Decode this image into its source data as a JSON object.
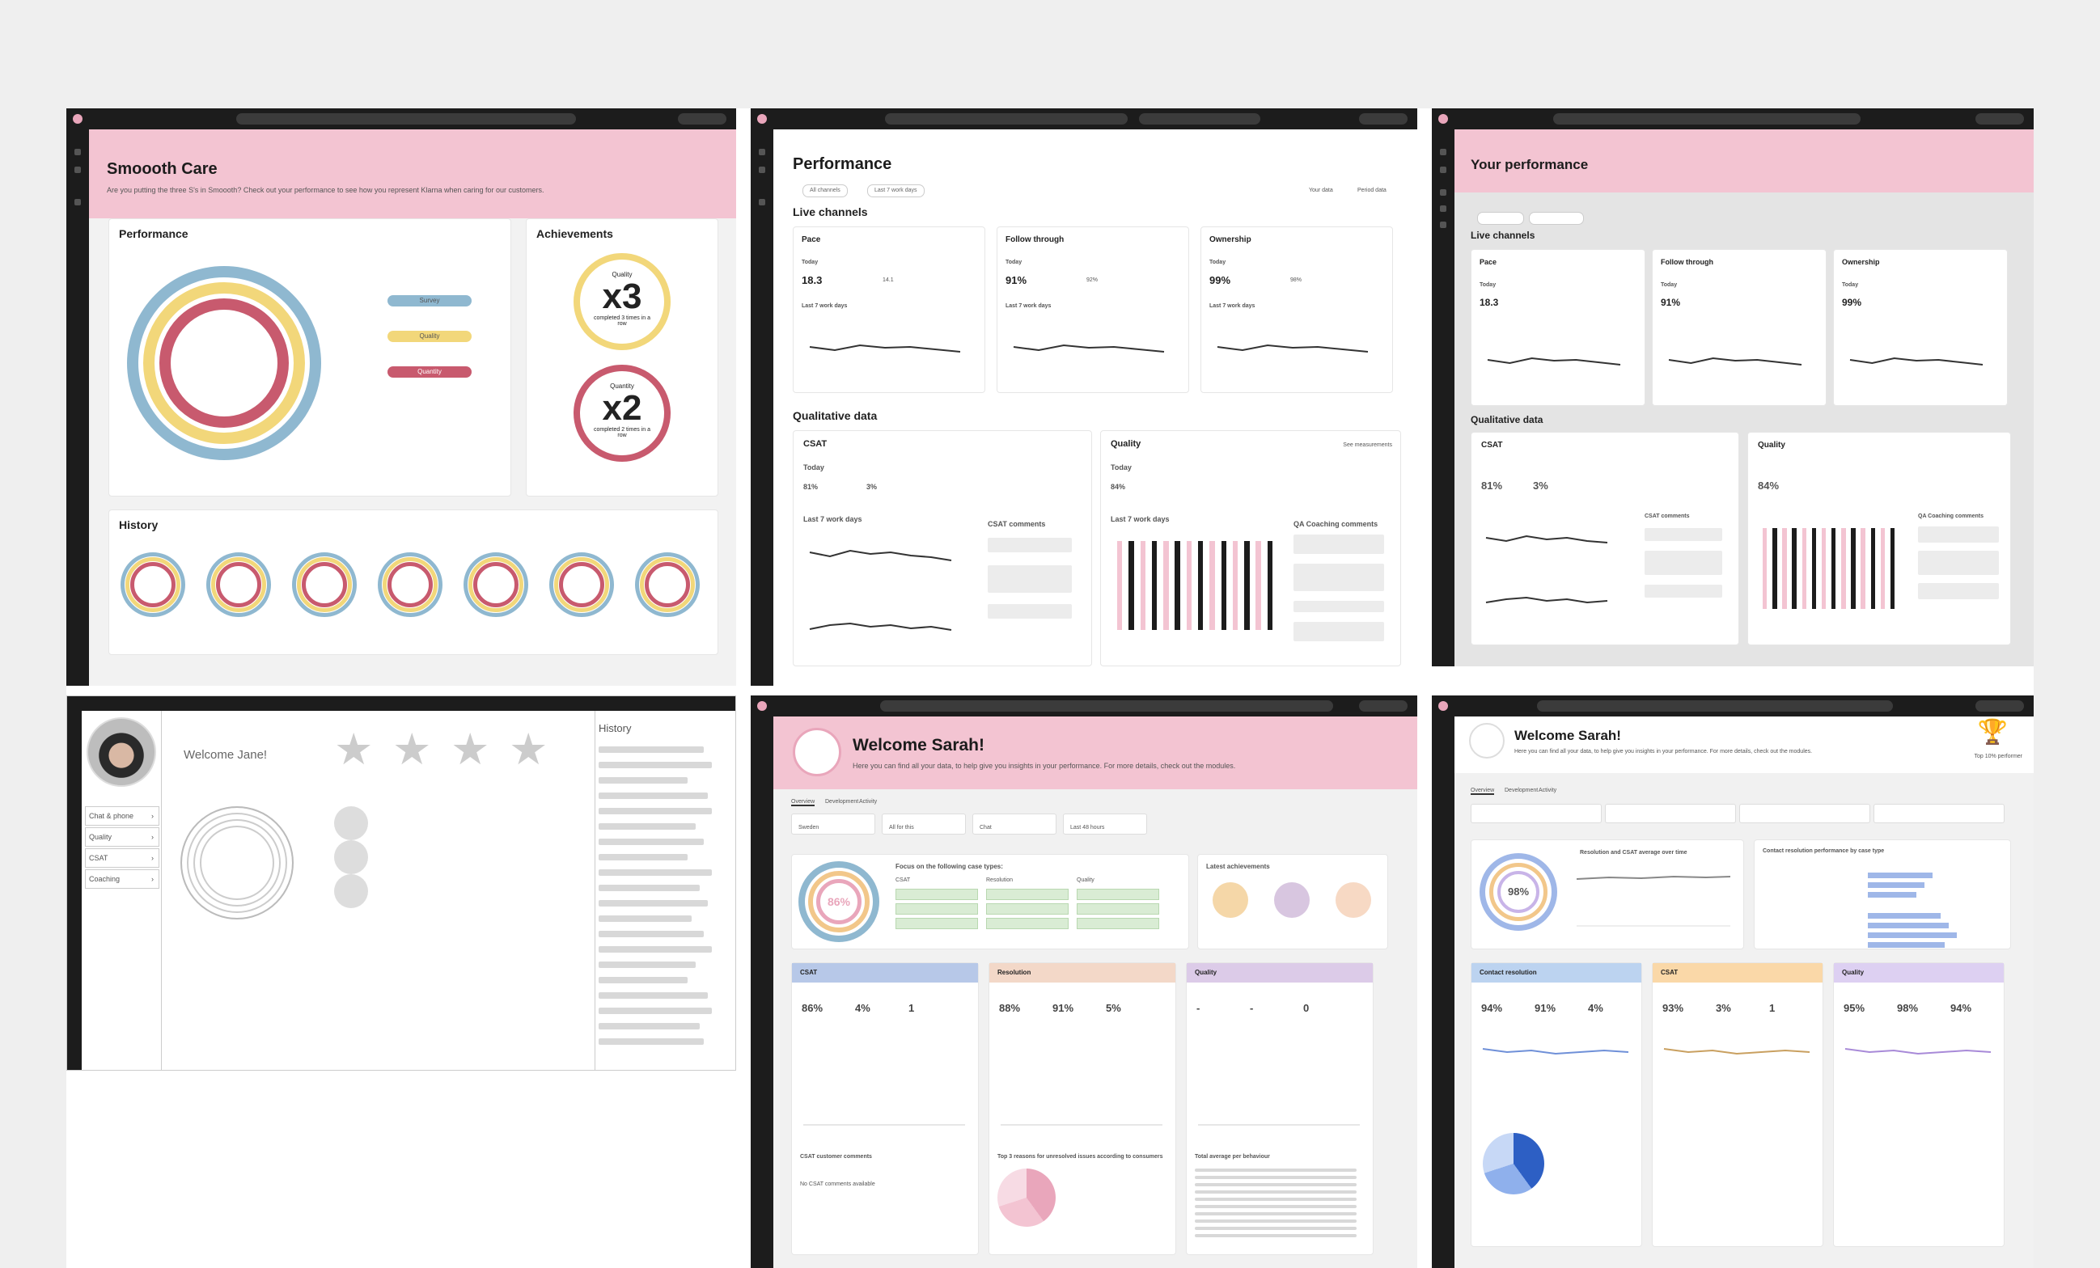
{
  "frames": {
    "smooth_care": {
      "title": "Smoooth Care",
      "subtitle": "Are you putting the three S's in Smoooth? Check out your performance to see how you represent Klarna when caring for our customers.",
      "performance_title": "Performance",
      "legend": [
        "Survey",
        "Quality",
        "Quantity"
      ],
      "achievements_title": "Achievements",
      "achievement_1": {
        "label": "Quality",
        "value": "x3",
        "caption": "completed 3 times in a row"
      },
      "achievement_2": {
        "label": "Quantity",
        "value": "x2",
        "caption": "completed 2 times in a row"
      },
      "history_title": "History"
    },
    "performance": {
      "title": "Performance",
      "filters": [
        "All channels",
        "Last 7 work days"
      ],
      "toggles": [
        "Your data",
        "Period data"
      ],
      "live_channels": "Live channels",
      "cards": [
        {
          "title": "Pace",
          "today_label": "Today",
          "value": "18.3",
          "delta": "14.1",
          "chart_label": "Last 7 work days"
        },
        {
          "title": "Follow through",
          "today_label": "Today",
          "value": "91%",
          "delta": "92%",
          "chart_label": "Last 7 work days"
        },
        {
          "title": "Ownership",
          "today_label": "Today",
          "value": "99%",
          "delta": "98%",
          "chart_label": "Last 7 work days"
        }
      ],
      "qualitative": "Qualitative data",
      "csat": {
        "title": "CSAT",
        "today_label": "Today",
        "value": "81%",
        "value2": "3%",
        "chart_label": "Last 7 work days",
        "comments_title": "CSAT comments"
      },
      "quality": {
        "title": "Quality",
        "today_label": "Today",
        "value": "84%",
        "chart_label": "Last 7 work days",
        "comments_title": "QA Coaching comments",
        "see_link": "See measurements"
      }
    },
    "your_performance": {
      "title": "Your performance",
      "live_channels": "Live channels",
      "cards": [
        {
          "title": "Pace",
          "today_label": "Today",
          "value": "18.3"
        },
        {
          "title": "Follow through",
          "today_label": "Today",
          "value": "91%"
        },
        {
          "title": "Ownership",
          "today_label": "Today",
          "value": "99%"
        }
      ],
      "qualitative": "Qualitative data",
      "csat": {
        "title": "CSAT",
        "value": "81%",
        "value2": "3%",
        "comments_title": "CSAT comments"
      },
      "quality": {
        "title": "Quality",
        "value": "84%",
        "comments_title": "QA Coaching comments"
      }
    },
    "wireframe": {
      "welcome": "Welcome Jane!",
      "history": "History",
      "menu": [
        "Chat & phone",
        "Quality",
        "CSAT",
        "Coaching"
      ],
      "star_glyph": "★"
    },
    "welcome_sarah_1": {
      "title": "Welcome Sarah!",
      "tabs": [
        "Overview",
        "Development",
        "Activity"
      ],
      "filters": [
        "Sweden",
        "All for this",
        "Chat",
        "Last 48 hours"
      ],
      "ring_value": "86%",
      "focus_title": "Focus on the following case types:",
      "focus_cols": [
        "CSAT",
        "Resolution",
        "Quality"
      ],
      "achievements_title": "Latest achievements",
      "sections": [
        {
          "title": "CSAT",
          "values": [
            "86%",
            "4%",
            "1"
          ]
        },
        {
          "title": "Resolution",
          "values": [
            "88%",
            "91%",
            "5%"
          ]
        },
        {
          "title": "Quality",
          "values": [
            "-",
            "-",
            "0"
          ]
        }
      ],
      "csat_comments": "CSAT customer comments",
      "csat_empty": "No CSAT comments available",
      "top_reasons": "Top 3 reasons for unresolved issues according to consumers",
      "total_avg": "Total average per behaviour"
    },
    "welcome_sarah_2": {
      "title": "Welcome Sarah!",
      "badge": "Top 10% performer",
      "tabs": [
        "Overview",
        "Development",
        "Activity"
      ],
      "ring_value": "98%",
      "chart1_title": "Resolution and CSAT average over time",
      "chart2_title": "Contact resolution performance by case type",
      "sections": [
        {
          "title": "Contact resolution",
          "values": [
            "94%",
            "91%",
            "4%"
          ]
        },
        {
          "title": "CSAT",
          "values": [
            "93%",
            "3%",
            "1"
          ]
        },
        {
          "title": "Quality",
          "values": [
            "95%",
            "98%",
            "94%"
          ]
        }
      ]
    }
  },
  "colors": {
    "pink": "#f3c4d2",
    "blue": "#8fb8d0",
    "yellow": "#f2d77a",
    "red": "#c85a6e",
    "dark": "#1c1c1c"
  }
}
